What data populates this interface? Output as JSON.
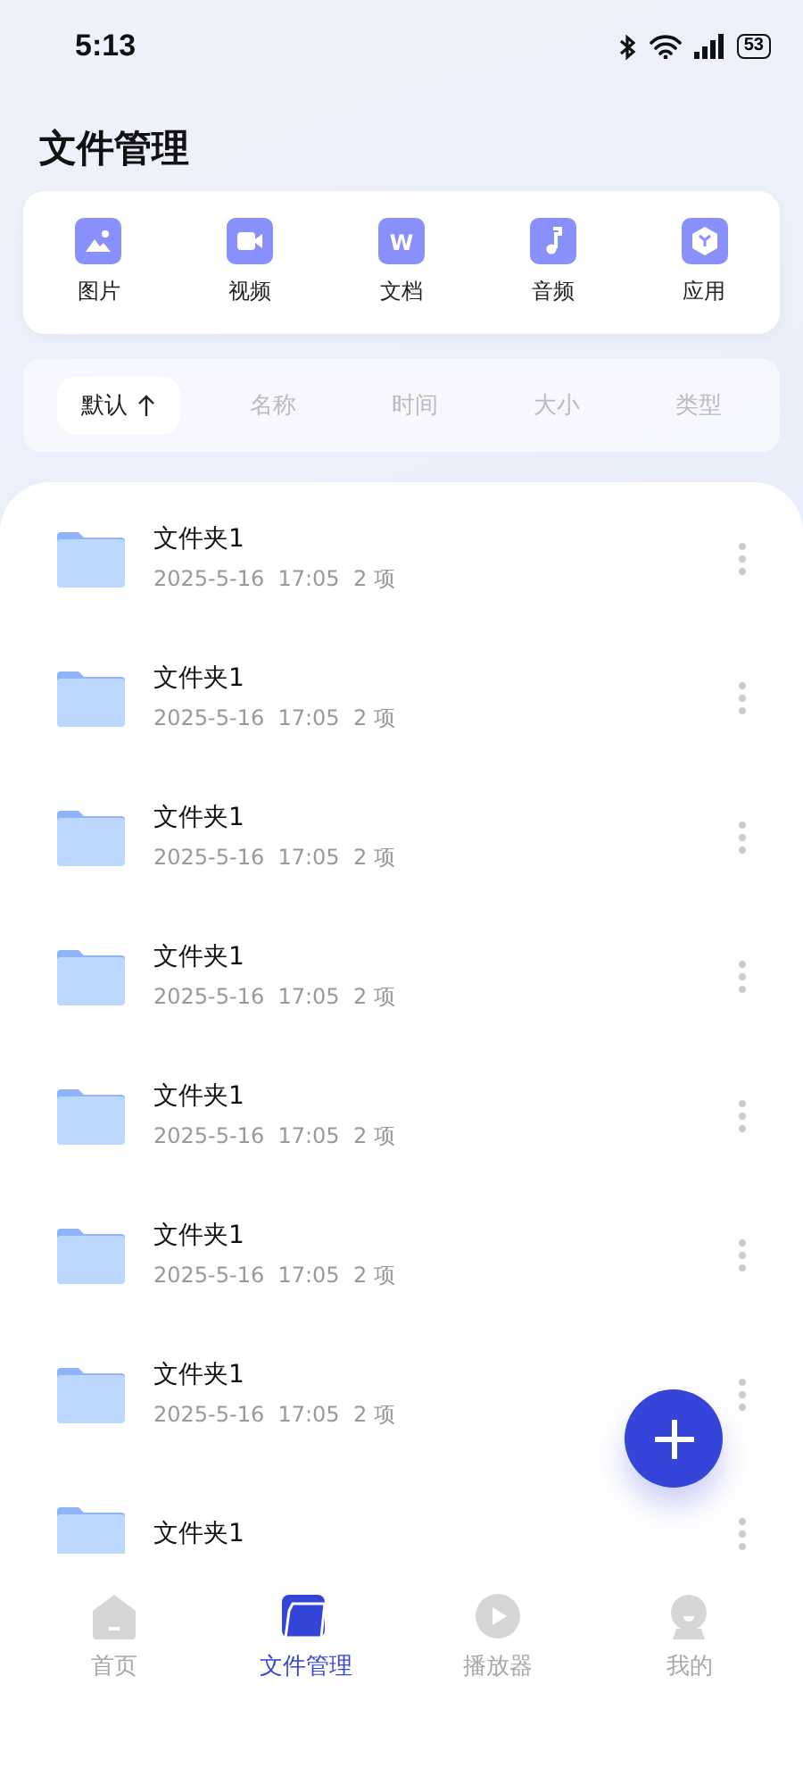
{
  "status_bar": {
    "time": "5:13",
    "battery": "53"
  },
  "title": "文件管理",
  "categories": [
    {
      "kind": "image",
      "label": "图片"
    },
    {
      "kind": "video",
      "label": "视频"
    },
    {
      "kind": "doc",
      "label": "文档",
      "badge": "W"
    },
    {
      "kind": "music",
      "label": "音频"
    },
    {
      "kind": "app",
      "label": "应用"
    }
  ],
  "sort_options": [
    {
      "label": "默认",
      "selected": true,
      "arrow": true
    },
    {
      "label": "名称",
      "selected": false
    },
    {
      "label": "时间",
      "selected": false
    },
    {
      "label": "大小",
      "selected": false
    },
    {
      "label": "类型",
      "selected": false
    }
  ],
  "files": [
    {
      "name": "文件夹1",
      "meta": "2025-5-16  17:05  2 项"
    },
    {
      "name": "文件夹1",
      "meta": "2025-5-16  17:05  2 项"
    },
    {
      "name": "文件夹1",
      "meta": "2025-5-16  17:05  2 项"
    },
    {
      "name": "文件夹1",
      "meta": "2025-5-16  17:05  2 项"
    },
    {
      "name": "文件夹1",
      "meta": "2025-5-16  17:05  2 项"
    },
    {
      "name": "文件夹1",
      "meta": "2025-5-16  17:05  2 项"
    },
    {
      "name": "文件夹1",
      "meta": "2025-5-16  17:05  2 项"
    },
    {
      "name": "文件夹1"
    }
  ],
  "tab_bar": [
    {
      "kind": "home",
      "label": "首页",
      "selected": false
    },
    {
      "kind": "folder",
      "label": "文件管理",
      "selected": true
    },
    {
      "kind": "play",
      "label": "播放器",
      "selected": false
    },
    {
      "kind": "user",
      "label": "我的",
      "selected": false
    }
  ]
}
